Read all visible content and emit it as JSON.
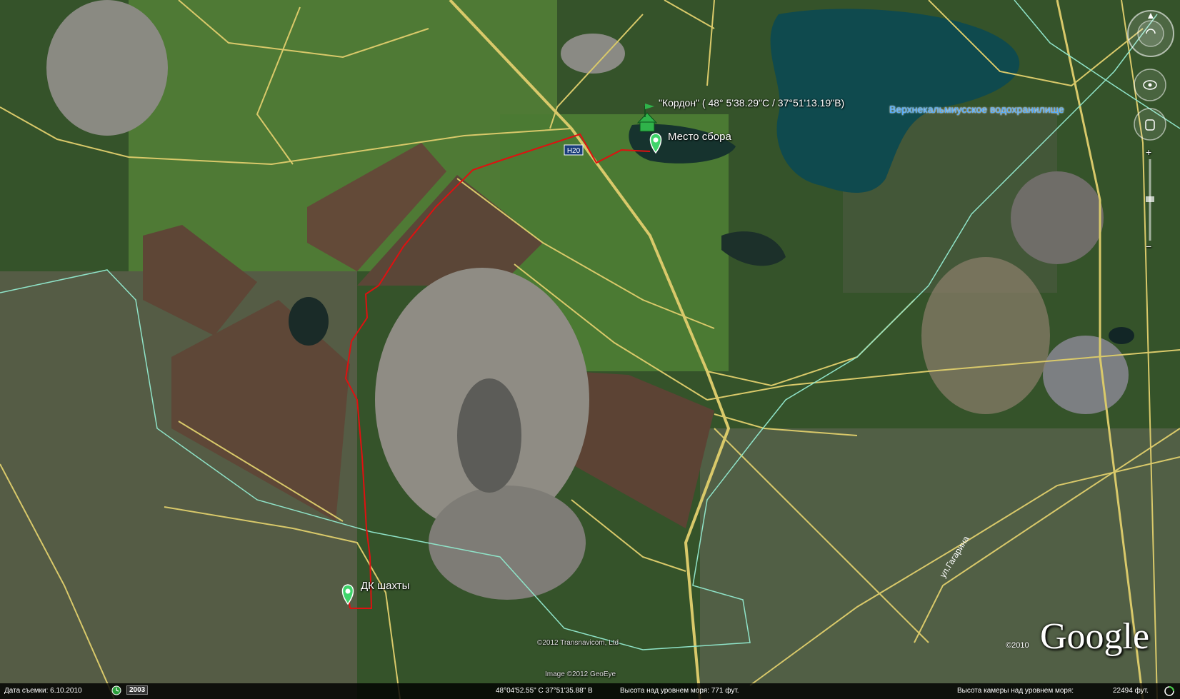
{
  "map": {
    "placemarks": {
      "kordon": "\"Кордон\" ( 48° 5'38.29\"С / 37°51'13.19\"В)",
      "meeting_point": "Место сбора",
      "dk_mine": "ДК шахты"
    },
    "labels": {
      "reservoir": "Верхнекальмиусское водохранилище",
      "highway": "Н20",
      "street": "ул.Гагарина"
    },
    "copyrights": {
      "transnavicom": "©2012 Transnavicom, Ltd",
      "geoeye": "Image ©2012 GeoEye",
      "google_year": "©2010",
      "google_logo": "Google"
    },
    "route_color": "#e01010",
    "boundary_color": "#8fe3c8",
    "road_color": "#d9c96a"
  },
  "statusbar": {
    "date_label": "Дата съемки: 6.10.2010",
    "year": "2003",
    "coordinates": "48°04'52.55\" С   37°51'35.88\" В",
    "elevation": "Высота над уровнем моря:   771 фут.",
    "eye_altitude": "Высота камеры над уровнем моря:",
    "eye_altitude_value": "22494 фут."
  },
  "controls": {
    "compass": "compass-icon",
    "zoom_plus": "+",
    "zoom_minus": "−"
  }
}
